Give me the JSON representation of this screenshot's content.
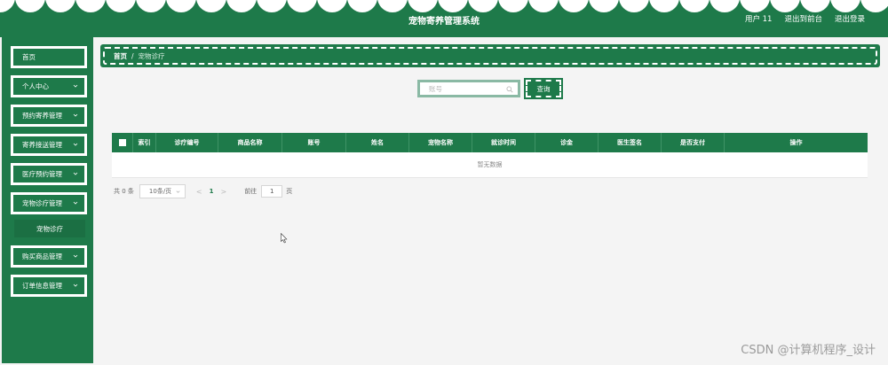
{
  "header": {
    "title": "宠物寄养管理系统",
    "user_label": "用户 11",
    "back_to_front": "退出到前台",
    "logout": "退出登录"
  },
  "sidebar": {
    "items": [
      {
        "label": "首页",
        "has_arrow": false
      },
      {
        "label": "个人中心",
        "has_arrow": true
      },
      {
        "label": "预约寄养管理",
        "has_arrow": true
      },
      {
        "label": "寄养接送管理",
        "has_arrow": true
      },
      {
        "label": "医疗预约管理",
        "has_arrow": true
      },
      {
        "label": "宠物诊疗管理",
        "has_arrow": true,
        "expanded": true
      },
      {
        "label": "购买商品管理",
        "has_arrow": true
      },
      {
        "label": "订单信息管理",
        "has_arrow": true
      }
    ],
    "sub_item": "宠物诊疗"
  },
  "breadcrumb": {
    "home": "首页",
    "separator": "/",
    "current": "宠物诊疗"
  },
  "search": {
    "placeholder": "账号",
    "value": "",
    "button_label": "查询"
  },
  "table": {
    "columns": [
      "",
      "索引",
      "诊疗编号",
      "商品名称",
      "账号",
      "姓名",
      "宠物名称",
      "就诊时间",
      "诊金",
      "医生签名",
      "是否支付",
      "操作"
    ],
    "empty_text": "暂无数据"
  },
  "pagination": {
    "total": "共 0 条",
    "page_size": "10条/页",
    "prev": "<",
    "current_page": "1",
    "next": ">",
    "goto_label": "前往",
    "goto_value": "1",
    "page_suffix": "页"
  },
  "watermark": "CSDN @计算机程序_设计",
  "colors": {
    "primary": "#1e7a4a",
    "background": "#f4f4f4",
    "white": "#ffffff"
  }
}
